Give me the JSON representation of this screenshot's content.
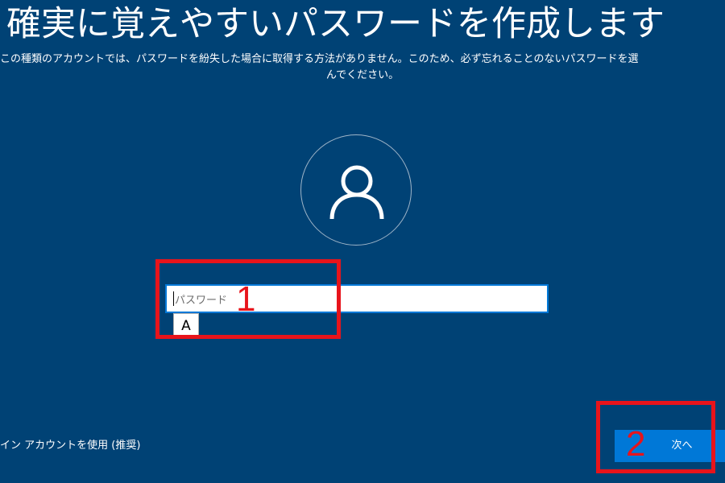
{
  "page": {
    "title": "確実に覚えやすいパスワードを作成します",
    "description_line1": "この種類のアカウントでは、パスワードを紛失した場合に取得する方法がありません。このため、必ず忘れることのないパスワードを選",
    "description_line2": "んでください。"
  },
  "avatar": {
    "icon": "user-icon"
  },
  "password_field": {
    "placeholder": "パスワード",
    "value": ""
  },
  "ime": {
    "mode": "A"
  },
  "footer": {
    "alt_signin_link": "イン アカウントを使用 (推奨)",
    "next_button": "次へ"
  },
  "annotations": {
    "marker_1": "1",
    "marker_2": "2",
    "color": "#e8141b"
  },
  "colors": {
    "background": "#004275",
    "accent": "#0078d7"
  }
}
